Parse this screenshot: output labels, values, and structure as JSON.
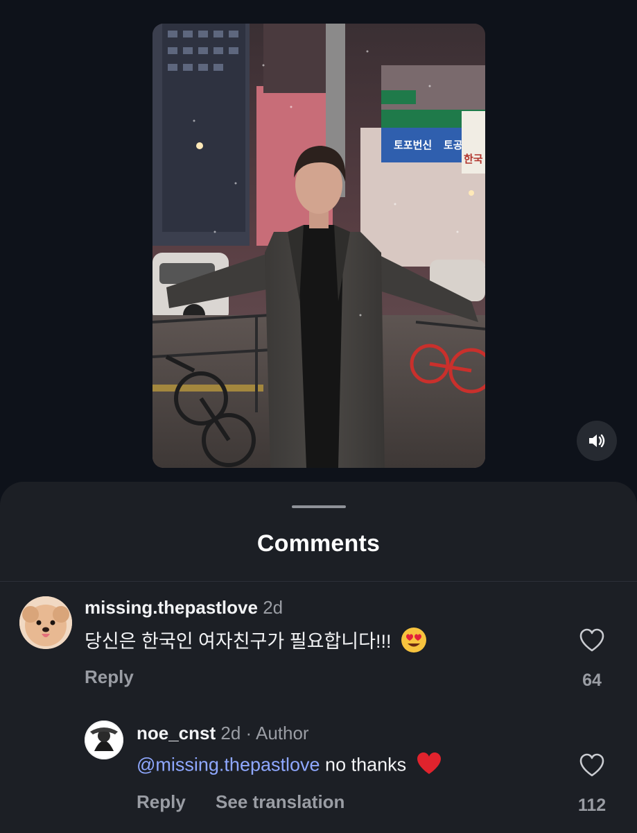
{
  "video": {
    "sign_text_left": "토포번신",
    "sign_text_right": "토공",
    "sign_side_text": "한국",
    "mute_icon": "speaker-muted-icon"
  },
  "comments_sheet": {
    "title": "Comments",
    "comments": [
      {
        "username": "missing.thepastlove",
        "meta": "2d",
        "text": "당신은 한국인 여자친구가 필요합니다!!!",
        "emoji": "heart-eyes-emoji",
        "reply_label": "Reply",
        "like_count": "64"
      }
    ],
    "reply": {
      "username": "noe_cnst",
      "meta": "2d · Author",
      "mention": "@missing.thepastlove",
      "text": "no thanks",
      "emoji": "red-heart-emoji",
      "reply_label": "Reply",
      "translate_label": "See translation",
      "like_count": "112"
    }
  },
  "colors": {
    "background": "#0e121a",
    "sheet": "#1c1f25",
    "mention": "#8fa8ff",
    "muted_text": "#9a9da4"
  }
}
